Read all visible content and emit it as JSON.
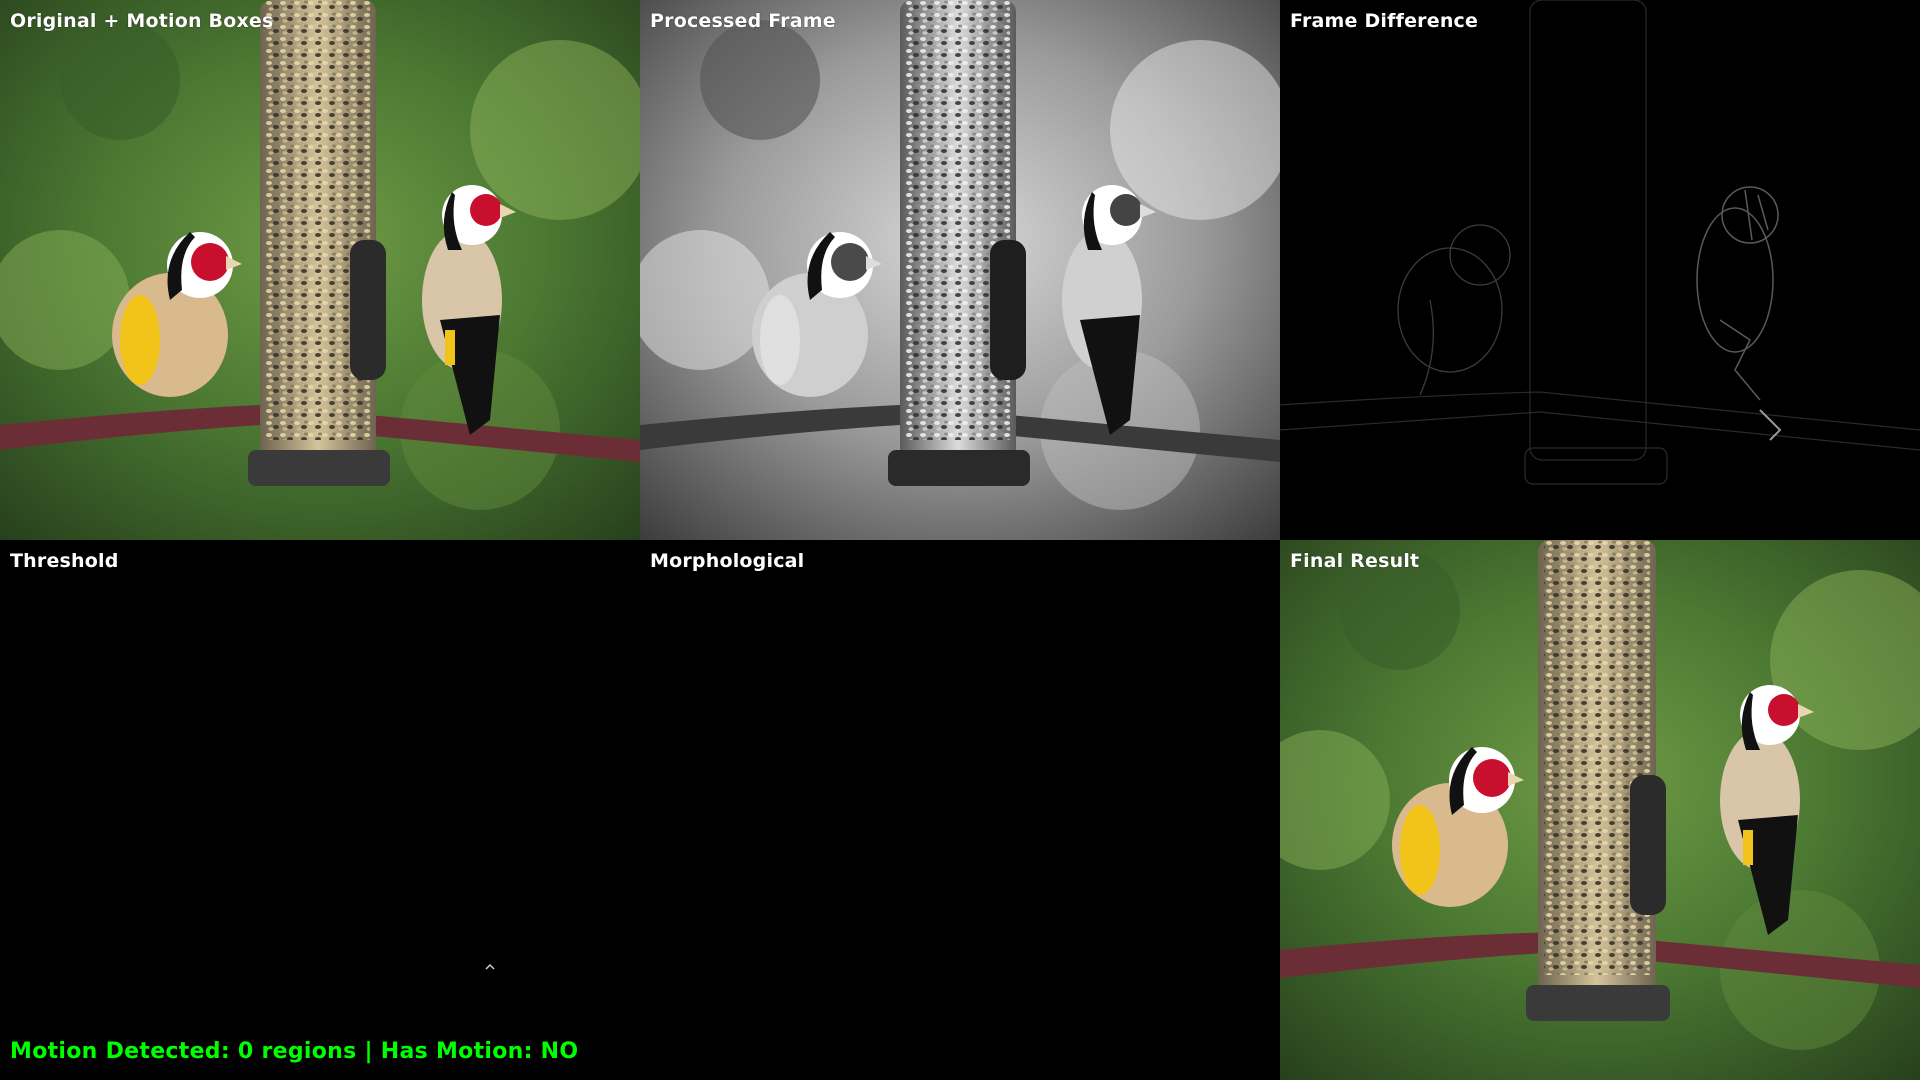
{
  "panels": {
    "original": {
      "title": "Original + Motion Boxes",
      "mode": "color",
      "image": "bird-feeder-scene"
    },
    "processed": {
      "title": "Processed Frame",
      "mode": "grayscale",
      "image": "bird-feeder-scene"
    },
    "difference": {
      "title": "Frame Difference",
      "mode": "faint-edges",
      "image": "bird-feeder-scene"
    },
    "threshold": {
      "title": "Threshold",
      "mode": "black",
      "image": "binary-mask"
    },
    "morphological": {
      "title": "Morphological",
      "mode": "black",
      "image": "binary-mask"
    },
    "final": {
      "title": "Final Result",
      "mode": "color",
      "image": "bird-feeder-scene"
    }
  },
  "status": {
    "text": "Motion Detected: 0 regions | Has Motion: NO",
    "color": "#00ff00"
  },
  "colors": {
    "background": "#000000",
    "title_text": "#ffffff",
    "status_text": "#00ff00",
    "foliage_dark": "#2f4a22",
    "foliage_light": "#7aa24a",
    "branch": "#6b2e36",
    "feeder_seed": "#c8b48a",
    "bird_red": "#c8102e",
    "bird_yellow": "#f2c318"
  }
}
